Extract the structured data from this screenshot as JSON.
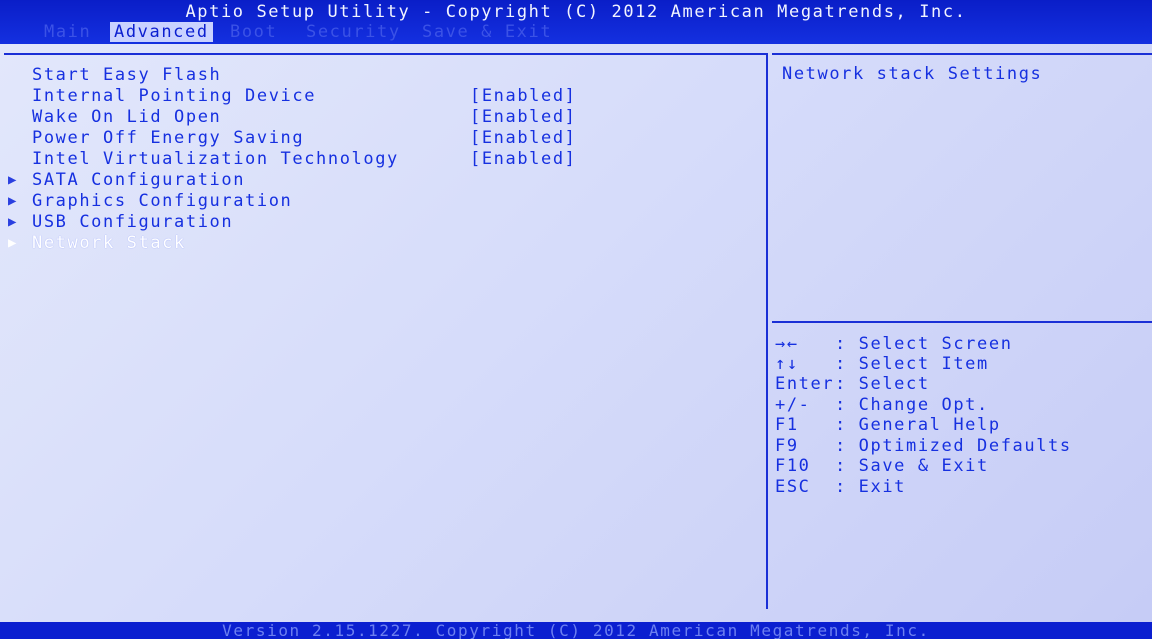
{
  "header": {
    "title": "Aptio Setup Utility - Copyright (C) 2012 American Megatrends, Inc.",
    "tabs": [
      "Main",
      "Advanced",
      "Boot",
      "Security",
      "Save & Exit"
    ]
  },
  "menu": [
    {
      "label": "Start Easy Flash",
      "value": "",
      "submenu": false
    },
    {
      "label": "Internal Pointing Device",
      "value": "[Enabled]",
      "submenu": false
    },
    {
      "label": "Wake On Lid Open",
      "value": "[Enabled]",
      "submenu": false
    },
    {
      "label": "Power Off Energy Saving",
      "value": "[Enabled]",
      "submenu": false
    },
    {
      "label": "Intel Virtualization Technology",
      "value": "[Enabled]",
      "submenu": false
    },
    {
      "label": "SATA Configuration",
      "value": "",
      "submenu": true
    },
    {
      "label": "Graphics Configuration",
      "value": "",
      "submenu": true
    },
    {
      "label": "USB Configuration",
      "value": "",
      "submenu": true
    },
    {
      "label": "Network Stack",
      "value": "",
      "submenu": true,
      "selected": true
    }
  ],
  "help": {
    "description": "Network stack Settings"
  },
  "keys": [
    {
      "key": "→←",
      "desc": ": Select Screen"
    },
    {
      "key": "↑↓",
      "desc": ": Select Item"
    },
    {
      "key": "Enter",
      "desc": ": Select"
    },
    {
      "key": "+/-",
      "desc": ": Change Opt."
    },
    {
      "key": "F1",
      "desc": ": General Help"
    },
    {
      "key": "F9",
      "desc": ": Optimized Defaults"
    },
    {
      "key": "F10",
      "desc": ": Save & Exit"
    },
    {
      "key": "ESC",
      "desc": ": Exit"
    }
  ],
  "footer": {
    "version": "Version 2.15.1227. Copyright (C) 2012 American Megatrends, Inc."
  },
  "colors": {
    "frame": "#0b1fd0",
    "panel": "#d6dcfa",
    "text": "#1630e0",
    "highlight": "#ffffff"
  }
}
